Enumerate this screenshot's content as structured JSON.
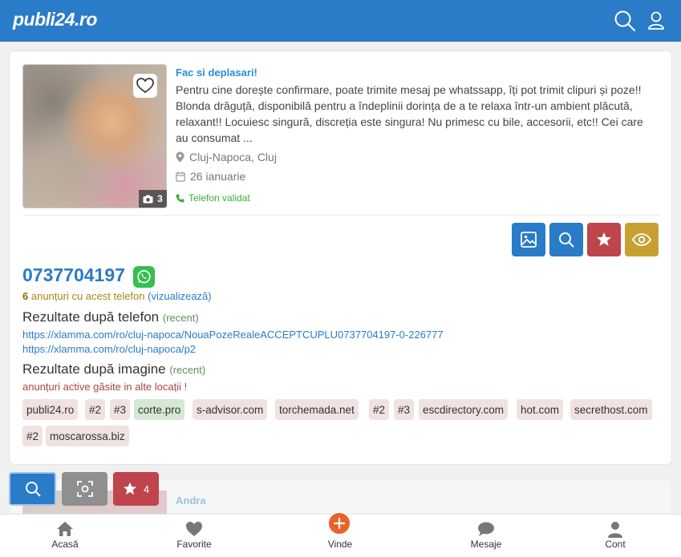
{
  "header": {
    "logo": "publi24.ro"
  },
  "listing": {
    "title": "Fac si deplasari!",
    "description": "Pentru cine dorește confirmare, poate trimite mesaj pe whatssapp, îți pot trimit clipuri și poze!! Blonda drăguță, disponibilă pentru a îndeplinii dorința de a te relaxa într-un ambient plăcută, relaxant!! Locuiesc singură, discreția este singura! Nu primesc cu bile, accesorii, etc!! Cei care au consumat ...",
    "location": "Cluj-Napoca, Cluj",
    "date": "26 ianuarie",
    "validated": "Telefon validat",
    "photo_count": "3"
  },
  "phone": {
    "number": "0737704197",
    "ads_count": "6",
    "ads_text": "anunțuri cu acest telefon",
    "ads_link": "(vizualizează)"
  },
  "phone_results": {
    "heading": "Rezultate după telefon",
    "sub": "(recent)",
    "urls": [
      "https://xlamma.com/ro/cluj-napoca/NouaPozeRealeACCEPTCUPLU0737704197-0-226777",
      "https://xlamma.com/ro/cluj-napoca/p2"
    ]
  },
  "image_results": {
    "heading": "Rezultate după imagine",
    "sub": "(recent)",
    "warning": "anunțuri active găsite in alte locații !",
    "tags": [
      "publi24.ro",
      "#2",
      "#3",
      "corte.pro",
      "s-advisor.com",
      "torchemada.net",
      "#2",
      "#3",
      "escdirectory.com",
      "hot.com",
      "secrethost.com",
      "#2",
      "moscarossa.biz"
    ]
  },
  "next_listing": {
    "title": "Andra"
  },
  "floating": {
    "favorites_count": "4"
  },
  "bottom_nav": {
    "home": "Acasă",
    "favorites": "Favorite",
    "sell": "Vinde",
    "messages": "Mesaje",
    "account": "Cont"
  },
  "colors": {
    "brand_blue": "#2a7bc8",
    "action_red": "#c0444c",
    "action_gold": "#c8a032",
    "whatsapp_green": "#33c04b",
    "plus_orange": "#e8622a"
  }
}
